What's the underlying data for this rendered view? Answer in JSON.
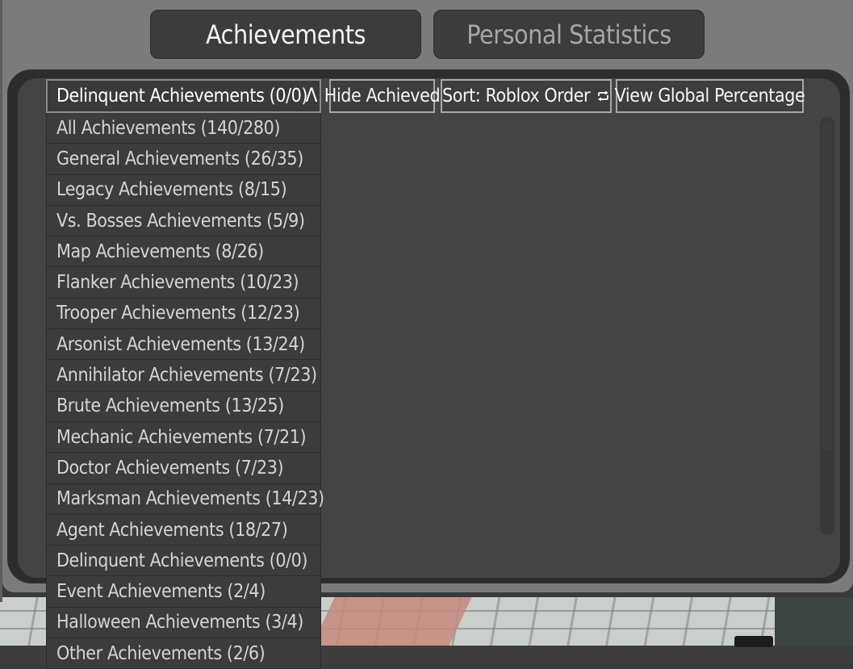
{
  "tabs": [
    {
      "label": "Achievements",
      "active": true
    },
    {
      "label": "Personal Statistics",
      "active": false
    }
  ],
  "toolbar": {
    "hide_label": "Hide Achieved",
    "sort_label": "Sort: Roblox Order",
    "sort_icon": "swap-icon",
    "global_label": "View Global Percentage"
  },
  "dropdown": {
    "selected": "Delinquent Achievements (0/0)",
    "caret": "Λ",
    "items": [
      "All Achievements (140/280)",
      "General Achievements (26/35)",
      "Legacy Achievements (8/15)",
      "Vs. Bosses Achievements (5/9)",
      "Map Achievements (8/26)",
      "Flanker Achievements (10/23)",
      "Trooper Achievements (12/23)",
      "Arsonist Achievements (13/24)",
      "Annihilator Achievements (7/23)",
      "Brute Achievements (13/25)",
      "Mechanic Achievements (7/21)",
      "Doctor Achievements (7/23)",
      "Marksman Achievements (14/23)",
      "Agent Achievements (18/27)",
      "Delinquent Achievements (0/0)",
      "Event Achievements (2/4)",
      "Halloween Achievements (3/4)",
      "Other Achievements (2/6)"
    ]
  },
  "colors": {
    "frame": "#7b7b7b",
    "panel_outer": "#2d2d2d",
    "panel_inner": "#444444",
    "button_bg": "#3d3d3d",
    "text_active": "#f2f2f2",
    "text_inactive": "#a6a6a6"
  }
}
